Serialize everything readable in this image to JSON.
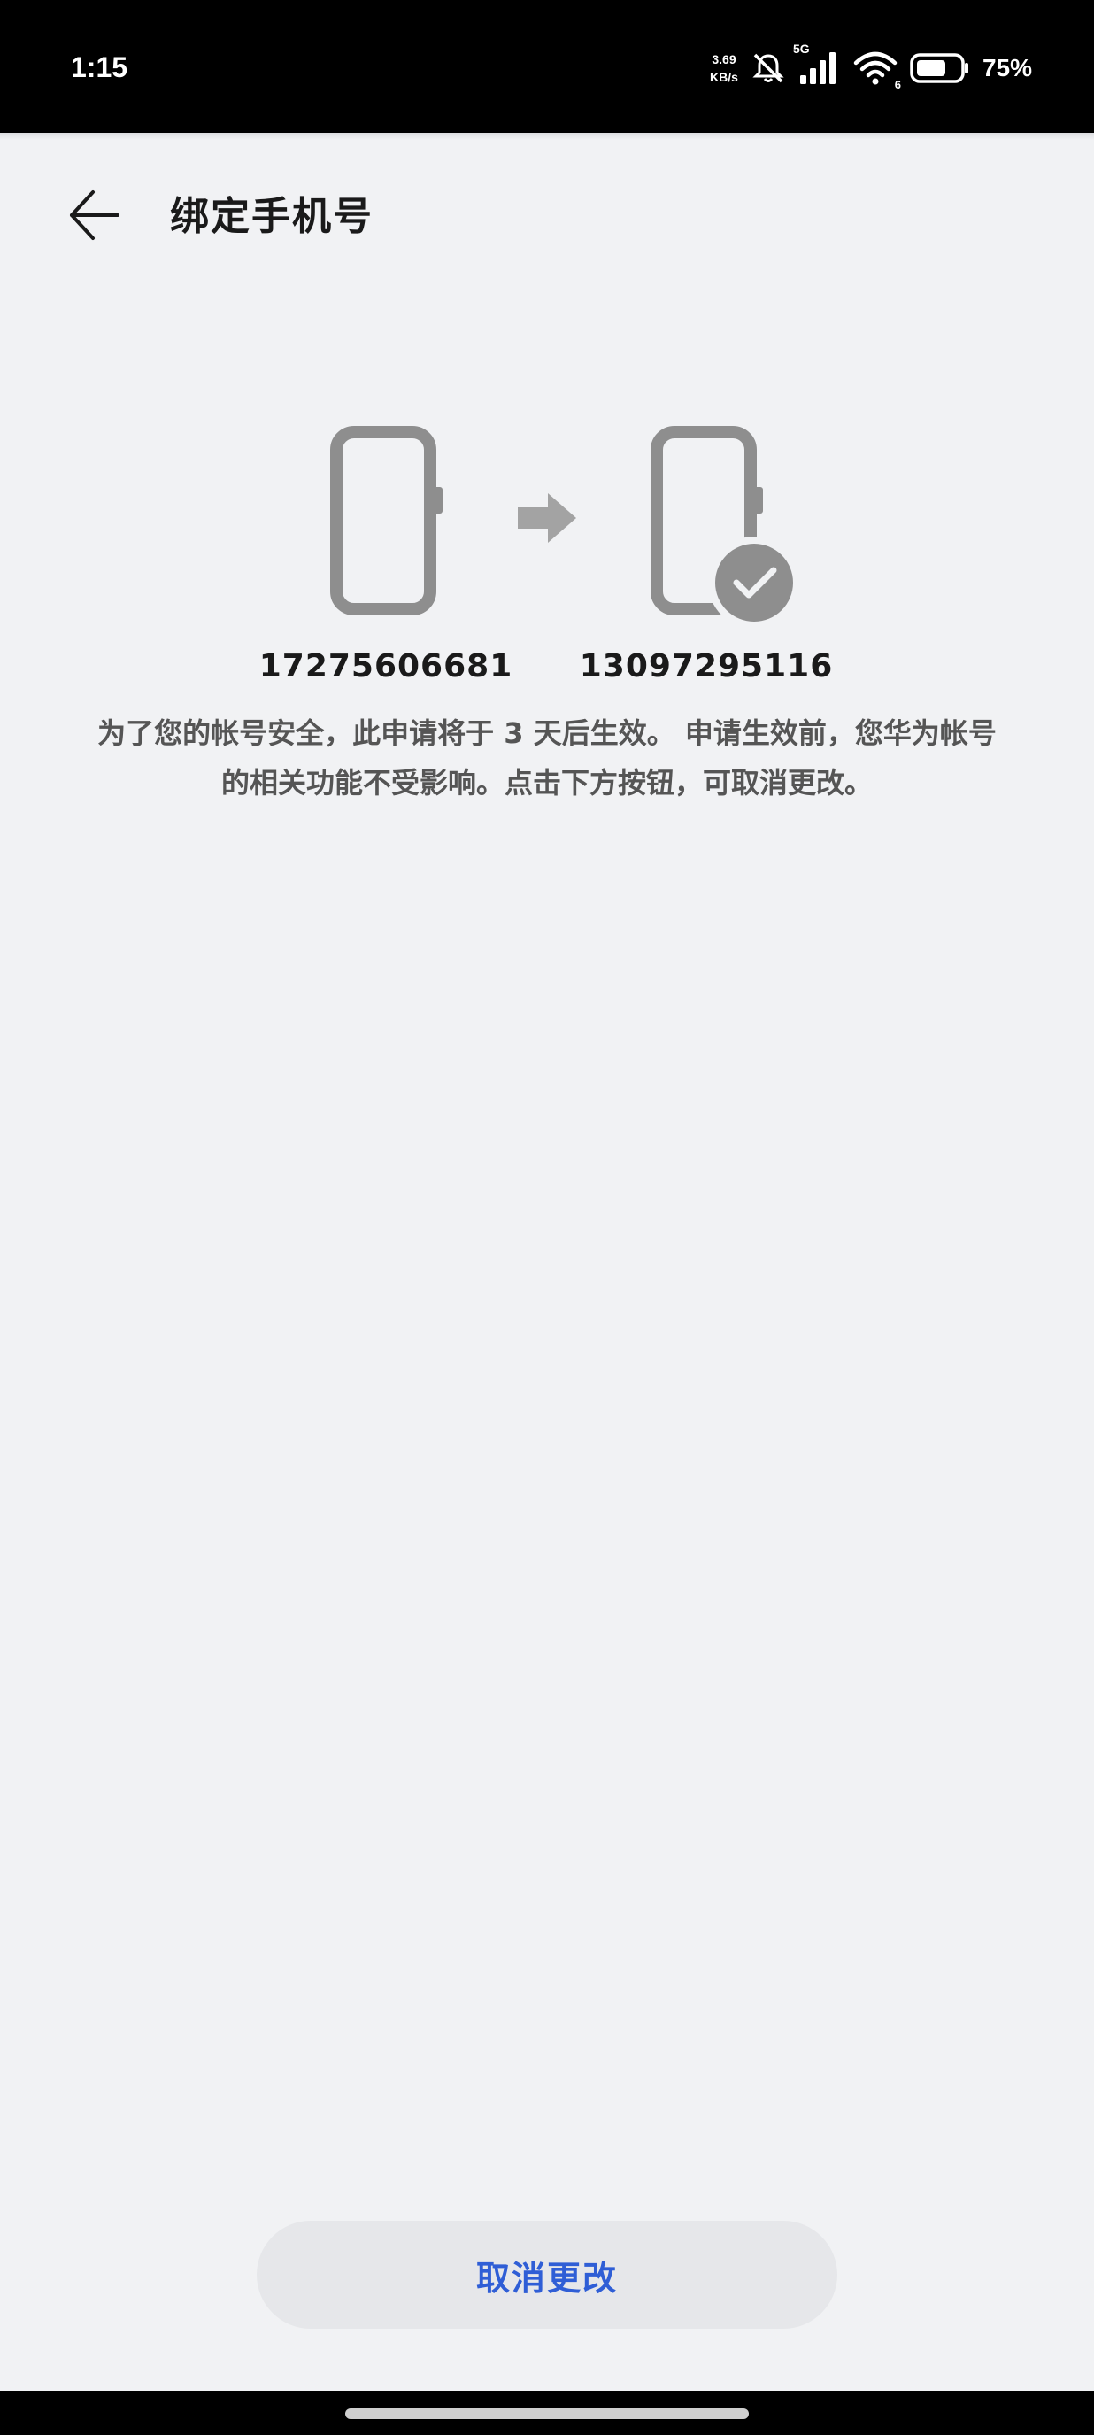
{
  "status_bar": {
    "time": "1:15",
    "net_speed_value": "3.69",
    "net_speed_unit": "KB/s",
    "network_type": "5G",
    "wifi_badge": "6",
    "battery_percent": "75%",
    "battery_level": 0.75
  },
  "header": {
    "title": "绑定手机号",
    "back_icon": "arrow-left-icon"
  },
  "illustration": {
    "old_number": "17275606681",
    "new_number": "13097295116",
    "old_phone_icon": "phone-icon",
    "arrow_icon": "arrow-right-icon",
    "new_phone_icon": "phone-verified-icon",
    "phone_color": "#8e8e8e",
    "arrow_color": "#a3a3a3"
  },
  "notice": {
    "line1": "为了您的帐号安全，此申请将于 3 天后生效。 申请生效前，您华为帐号",
    "line2": "的相关功能不受影响。点击下方按钮，可取消更改。"
  },
  "actions": {
    "cancel_label": "取消更改",
    "cancel_color": "#2f5ed6"
  }
}
